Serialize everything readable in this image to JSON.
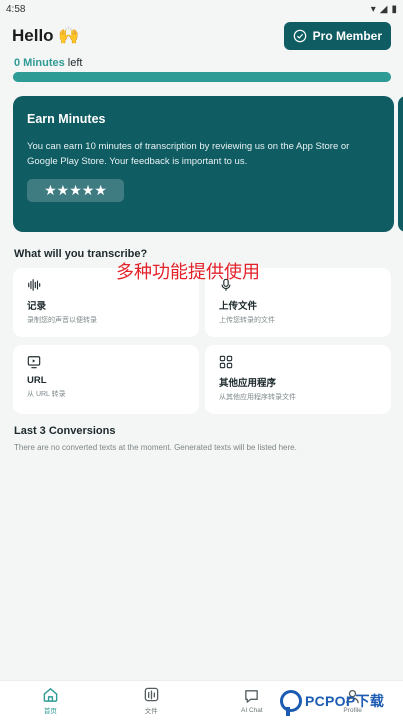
{
  "status": {
    "time": "4:58"
  },
  "header": {
    "greeting": "Hello 🙌",
    "pro_label": "Pro Member"
  },
  "minutes": {
    "count": "0 Minutes",
    "suffix": " left",
    "progress_fraction": 1.0
  },
  "earn_card": {
    "title": "Earn Minutes",
    "description": "You can earn 10 minutes of transcription by reviewing us on the App Store or Google Play Store. Your feedback is important to us.",
    "stars": "★★★★★"
  },
  "transcribe": {
    "title": "What will you transcribe?"
  },
  "overlay_text": "多种功能提供使用",
  "tiles": [
    {
      "title": "记录",
      "subtitle": "录制您的声音以便转录",
      "icon": "waveform-icon"
    },
    {
      "title": "上传文件",
      "subtitle": "上传您转录的文件",
      "icon": "microphone-icon"
    },
    {
      "title": "URL",
      "subtitle": "从 URL 转录",
      "icon": "monitor-icon"
    },
    {
      "title": "其他应用程序",
      "subtitle": "从其他应用程序转录文件",
      "icon": "apps-grid-icon"
    }
  ],
  "conversions": {
    "title": "Last 3 Conversions",
    "empty": "There are no converted texts at the moment. Generated texts will be listed here."
  },
  "nav": [
    {
      "label": "首页",
      "icon": "home-icon",
      "active": true
    },
    {
      "label": "文件",
      "icon": "files-icon",
      "active": false
    },
    {
      "label": "AI Chat",
      "icon": "chat-icon",
      "active": false
    },
    {
      "label": "Profile",
      "icon": "profile-icon",
      "active": false
    }
  ],
  "watermark": {
    "logo_text": "PCPOP下载"
  },
  "colors": {
    "primary": "#105c63",
    "accent": "#2f9b95",
    "progress_track": "#69bcb6",
    "overlay_red": "#e3232b"
  }
}
